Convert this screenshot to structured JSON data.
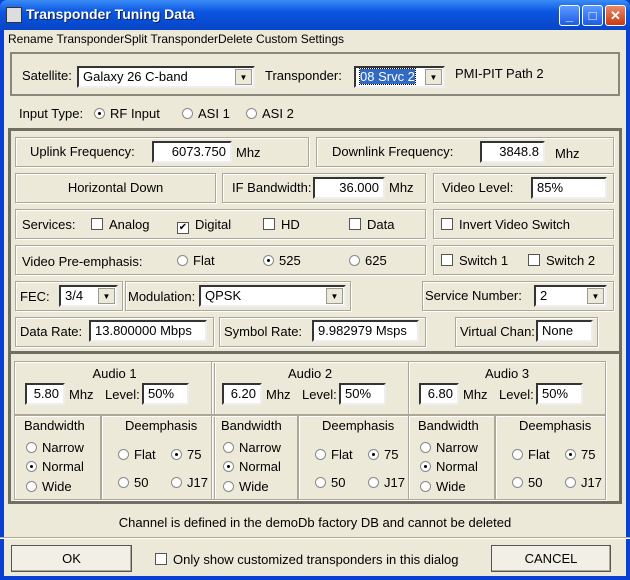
{
  "window": {
    "title": "Transponder Tuning Data"
  },
  "menu": [
    "Rename Transponder",
    "Split Transponder",
    "Delete Custom Settings"
  ],
  "satellite": {
    "label": "Satellite:",
    "value": "Galaxy 26  C-band"
  },
  "transponder": {
    "label": "Transponder:",
    "value": "08 Srvc 2",
    "description": "PMI-PIT Path 2"
  },
  "input_type": {
    "label": "Input Type:",
    "options": [
      "RF Input",
      "ASI 1",
      "ASI 2"
    ],
    "selected": "RF Input"
  },
  "uplink": {
    "label": "Uplink Frequency:",
    "value": "6073.750",
    "unit": "Mhz"
  },
  "downlink": {
    "label": "Downlink Frequency:",
    "value": "3848.8",
    "unit": "Mhz"
  },
  "polarity": "Horizontal Down",
  "if_bw": {
    "label": "IF Bandwidth:",
    "value": "36.000",
    "unit": "Mhz"
  },
  "video_level": {
    "label": "Video Level:",
    "value": "85%"
  },
  "services": {
    "label": "Services:",
    "options": [
      {
        "label": "Analog",
        "checked": false
      },
      {
        "label": "Digital",
        "checked": true
      },
      {
        "label": "HD",
        "checked": false
      },
      {
        "label": "Data",
        "checked": false
      }
    ]
  },
  "invert_video": {
    "label": "Invert Video Switch",
    "checked": false
  },
  "preemphasis": {
    "label": "Video Pre-emphasis:",
    "options": [
      "Flat",
      "525",
      "625"
    ],
    "selected": "525"
  },
  "switches": [
    {
      "label": "Switch 1",
      "checked": false
    },
    {
      "label": "Switch 2",
      "checked": false
    }
  ],
  "fec": {
    "label": "FEC:",
    "value": "3/4"
  },
  "modulation": {
    "label": "Modulation:",
    "value": "QPSK"
  },
  "service_number": {
    "label": "Service Number:",
    "value": "2"
  },
  "data_rate": {
    "label": "Data Rate:",
    "value": "13.800000 Mbps"
  },
  "symbol_rate": {
    "label": "Symbol Rate:",
    "value": "9.982979 Msps"
  },
  "virtual_chan": {
    "label": "Virtual Chan:",
    "value": "None"
  },
  "audio_labels": {
    "mhz": "Mhz",
    "level": "Level:",
    "bandwidth": "Bandwidth",
    "deemphasis": "Deemphasis",
    "narrow": "Narrow",
    "normal": "Normal",
    "wide": "Wide",
    "flat": "Flat",
    "d75": "75",
    "d50": "50",
    "j17": "J17"
  },
  "audio": [
    {
      "title": "Audio 1",
      "freq": "5.80",
      "level": "50%",
      "bandwidth": "Normal",
      "deemphasis": "75"
    },
    {
      "title": "Audio 2",
      "freq": "6.20",
      "level": "50%",
      "bandwidth": "Normal",
      "deemphasis": "75"
    },
    {
      "title": "Audio 3",
      "freq": "6.80",
      "level": "50%",
      "bandwidth": "Normal",
      "deemphasis": "75"
    }
  ],
  "message": "Channel is defined in the demoDb factory DB and cannot be deleted",
  "footer": {
    "ok": "OK",
    "only_custom": "Only show customized transponders  in this dialog",
    "cancel": "CANCEL"
  }
}
